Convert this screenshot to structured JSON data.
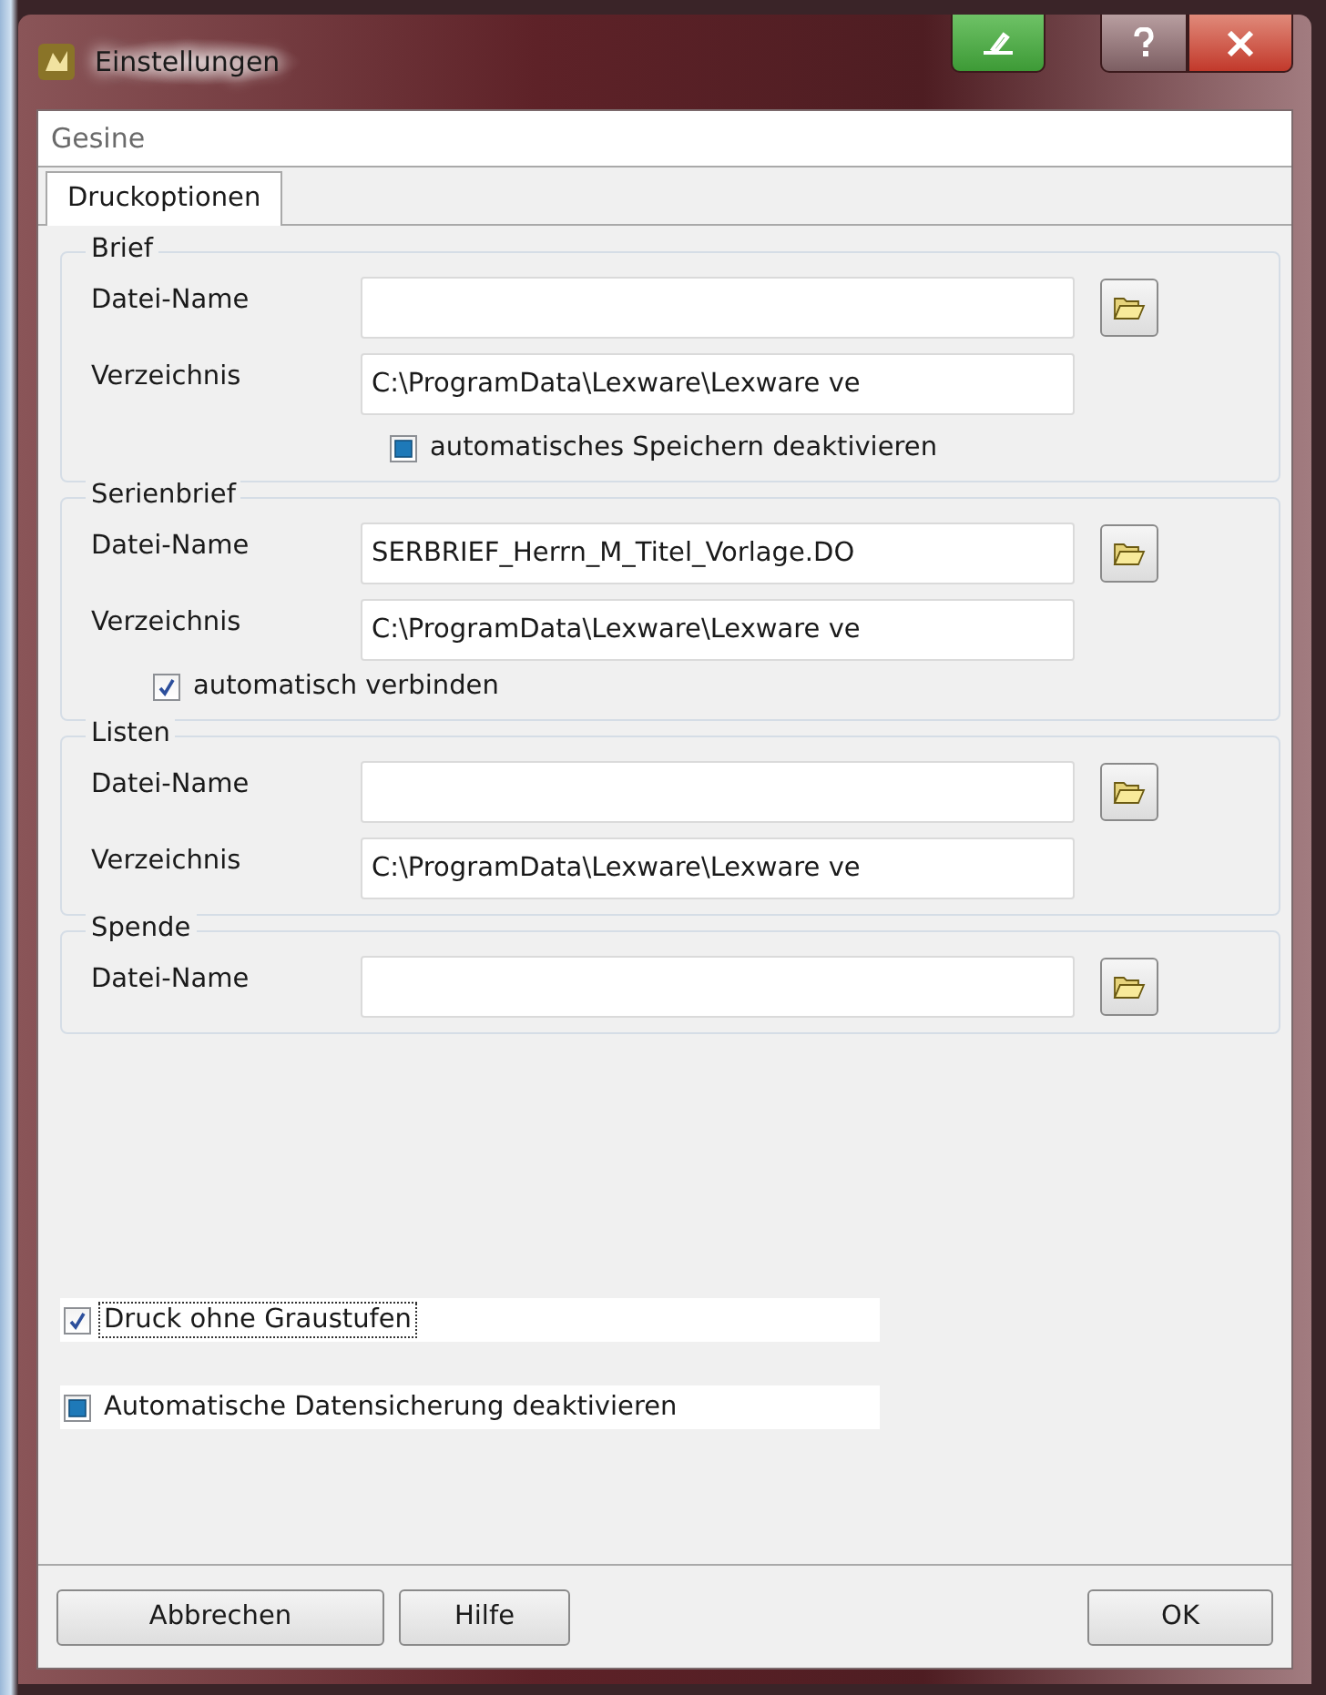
{
  "window": {
    "title": "Einstellungen"
  },
  "header": {
    "text": "Gesine"
  },
  "tabs": [
    {
      "label": "Druckoptionen",
      "selected": true
    }
  ],
  "groups": [
    {
      "title": "Brief",
      "rows": [
        {
          "kind": "field",
          "label": "Datei-Name",
          "browse": true
        },
        {
          "kind": "field",
          "label": "Verzeichnis",
          "value": "C:\\ProgramData\\Lexware\\Lexware ve",
          "browse": false
        },
        {
          "kind": "subcheckbox",
          "label": "automatisches Speichern deaktivieren",
          "checked": false,
          "indeterminate": true
        }
      ]
    },
    {
      "title": "Serienbrief",
      "rows": [
        {
          "kind": "field",
          "label": "Datei-Name",
          "value": "SERBRIEF_Herrn_M_Titel_Vorlage.DO",
          "browse": true
        },
        {
          "kind": "field",
          "label": "Verzeichnis",
          "value": "C:\\ProgramData\\Lexware\\Lexware ve",
          "browse": false
        },
        {
          "kind": "checkbox",
          "label": "automatisch verbinden",
          "checked": true,
          "indeterminate": false
        }
      ]
    },
    {
      "title": "Listen",
      "rows": [
        {
          "kind": "field",
          "label": "Datei-Name",
          "browse": true
        },
        {
          "kind": "field",
          "label": "Verzeichnis",
          "value": "C:\\ProgramData\\Lexware\\Lexware ve",
          "browse": false
        }
      ]
    },
    {
      "title": "Spende",
      "rows": [
        {
          "kind": "field",
          "label": "Datei-Name",
          "browse": true
        }
      ]
    }
  ],
  "options": [
    {
      "label": "Druck ohne Graustufen",
      "checked": true,
      "indeterminate": false,
      "focused": true
    },
    {
      "label": "Automatische Datensicherung deaktivieren",
      "checked": false,
      "indeterminate": true,
      "focused": false
    }
  ],
  "buttons_left": [
    {
      "label": "Abbrechen"
    },
    {
      "label": "Hilfe"
    }
  ],
  "buttons_right": [
    {
      "label": "OK"
    }
  ]
}
